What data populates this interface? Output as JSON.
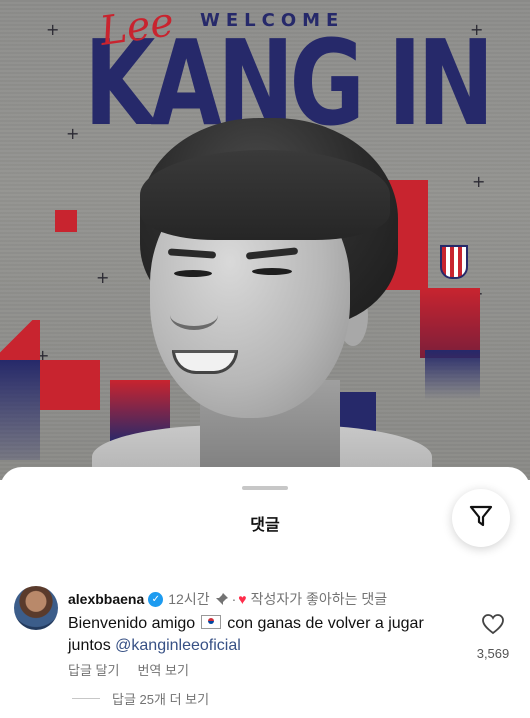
{
  "poster": {
    "script_name": "Lee",
    "welcome": "WELCOME",
    "name": "KANG IN"
  },
  "sheet": {
    "title": "댓글"
  },
  "comment": {
    "username": "alexbbaena",
    "time": "12시간",
    "separator": "·",
    "liked_by_author": "작성자가 좋아하는 댓글",
    "text_before_flag": "Bienvenido amigo",
    "text_after_flag": "con ganas de volver a jugar juntos",
    "mention": "@kanginleeoficial",
    "reply": "답글 달기",
    "translate": "번역 보기",
    "like_count": "3,569",
    "more_replies": "답글 25개 더 보기"
  },
  "colors": {
    "navy": "#26296a",
    "red": "#c8242f",
    "verified": "#1d9bf0",
    "mention": "#385185"
  },
  "icons": [
    "filter-icon",
    "verified-badge-icon",
    "pin-icon",
    "heart-icon",
    "like-heart-icon",
    "south-korea-flag-icon",
    "atletico-crest-icon"
  ]
}
